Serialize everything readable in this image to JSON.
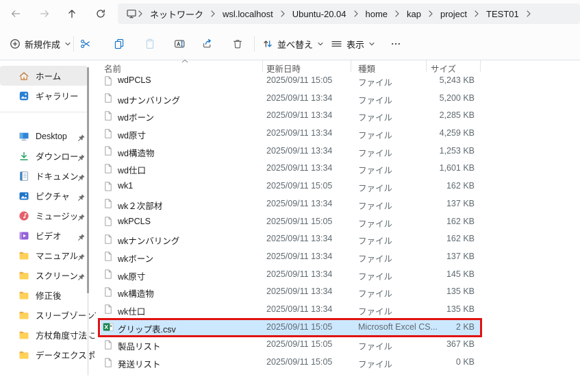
{
  "nav": {
    "breadcrumb_segments": [
      "ネットワーク",
      "wsl.localhost",
      "Ubuntu-20.04",
      "home",
      "kap",
      "project",
      "TEST01"
    ]
  },
  "toolbar": {
    "new_label": "新規作成",
    "sort_label": "並べ替え",
    "view_label": "表示"
  },
  "sidebar": {
    "quick_items": [
      {
        "label": "ホーム",
        "icon": "home-icon",
        "selected": true,
        "pinned": false
      },
      {
        "label": "ギャラリー",
        "icon": "gallery-icon",
        "selected": false,
        "pinned": false
      }
    ],
    "tree_items": [
      {
        "label": "Desktop",
        "icon": "desktop-icon",
        "pinned": true
      },
      {
        "label": "ダウンロード",
        "icon": "download-icon",
        "pinned": true
      },
      {
        "label": "ドキュメント",
        "icon": "document-icon",
        "pinned": true
      },
      {
        "label": "ピクチャ",
        "icon": "pictures-icon",
        "pinned": true
      },
      {
        "label": "ミュージック",
        "icon": "music-icon",
        "pinned": true
      },
      {
        "label": "ビデオ",
        "icon": "video-icon",
        "pinned": true
      },
      {
        "label": "マニュアル",
        "icon": "folder-icon",
        "pinned": true
      },
      {
        "label": "スクリーンショッ",
        "icon": "folder-icon",
        "pinned": true
      },
      {
        "label": "修正後",
        "icon": "folder-icon",
        "pinned": false
      },
      {
        "label": "スリーブゾーンType",
        "icon": "folder-icon",
        "pinned": false
      },
      {
        "label": "方杖角度寸法に",
        "icon": "folder-icon",
        "pinned": false
      },
      {
        "label": "データエクスポート",
        "icon": "folder-icon",
        "pinned": false
      }
    ]
  },
  "files": {
    "columns": {
      "name": "名前",
      "modified": "更新日時",
      "type": "種類",
      "size": "サイズ"
    },
    "sort": {
      "column": "名前",
      "direction": "asc"
    },
    "rows": [
      {
        "name": "wdPCLS",
        "modified": "2025/09/11 15:05",
        "type": "ファイル",
        "size": "5,243 KB",
        "icon": "file-icon",
        "selected": false
      },
      {
        "name": "wdナンバリング",
        "modified": "2025/09/11 13:34",
        "type": "ファイル",
        "size": "5,200 KB",
        "icon": "file-icon",
        "selected": false
      },
      {
        "name": "wdボーン",
        "modified": "2025/09/11 13:34",
        "type": "ファイル",
        "size": "2,285 KB",
        "icon": "file-icon",
        "selected": false
      },
      {
        "name": "wd原寸",
        "modified": "2025/09/11 13:34",
        "type": "ファイル",
        "size": "4,259 KB",
        "icon": "file-icon",
        "selected": false
      },
      {
        "name": "wd構造物",
        "modified": "2025/09/11 13:34",
        "type": "ファイル",
        "size": "1,253 KB",
        "icon": "file-icon",
        "selected": false
      },
      {
        "name": "wd仕口",
        "modified": "2025/09/11 13:34",
        "type": "ファイル",
        "size": "1,601 KB",
        "icon": "file-icon",
        "selected": false
      },
      {
        "name": "wk1",
        "modified": "2025/09/11 15:05",
        "type": "ファイル",
        "size": "162 KB",
        "icon": "file-icon",
        "selected": false
      },
      {
        "name": "wk２次部材",
        "modified": "2025/09/11 13:34",
        "type": "ファイル",
        "size": "137 KB",
        "icon": "file-icon",
        "selected": false
      },
      {
        "name": "wkPCLS",
        "modified": "2025/09/11 15:05",
        "type": "ファイル",
        "size": "162 KB",
        "icon": "file-icon",
        "selected": false
      },
      {
        "name": "wkナンバリング",
        "modified": "2025/09/11 13:34",
        "type": "ファイル",
        "size": "162 KB",
        "icon": "file-icon",
        "selected": false
      },
      {
        "name": "wkボーン",
        "modified": "2025/09/11 13:34",
        "type": "ファイル",
        "size": "137 KB",
        "icon": "file-icon",
        "selected": false
      },
      {
        "name": "wk原寸",
        "modified": "2025/09/11 13:34",
        "type": "ファイル",
        "size": "145 KB",
        "icon": "file-icon",
        "selected": false
      },
      {
        "name": "wk構造物",
        "modified": "2025/09/11 13:34",
        "type": "ファイル",
        "size": "135 KB",
        "icon": "file-icon",
        "selected": false
      },
      {
        "name": "wk仕口",
        "modified": "2025/09/11 13:34",
        "type": "ファイル",
        "size": "135 KB",
        "icon": "file-icon",
        "selected": false
      },
      {
        "name": "グリップ表.csv",
        "modified": "2025/09/11 15:05",
        "type": "Microsoft Excel CS...",
        "size": "2 KB",
        "icon": "excel-csv-icon",
        "selected": true,
        "highlight_annotation": true
      },
      {
        "name": "製品リスト",
        "modified": "2025/09/11 15:05",
        "type": "ファイル",
        "size": "367 KB",
        "icon": "file-icon",
        "selected": false
      },
      {
        "name": "発送リスト",
        "modified": "2025/09/11 15:05",
        "type": "ファイル",
        "size": "0 KB",
        "icon": "file-icon",
        "selected": false
      }
    ]
  },
  "colors": {
    "accent_blue": "#0b6ec6",
    "selection_blue": "#cce8ff",
    "annotation_red": "#e01212",
    "folder_yellow": "#ffd158"
  }
}
